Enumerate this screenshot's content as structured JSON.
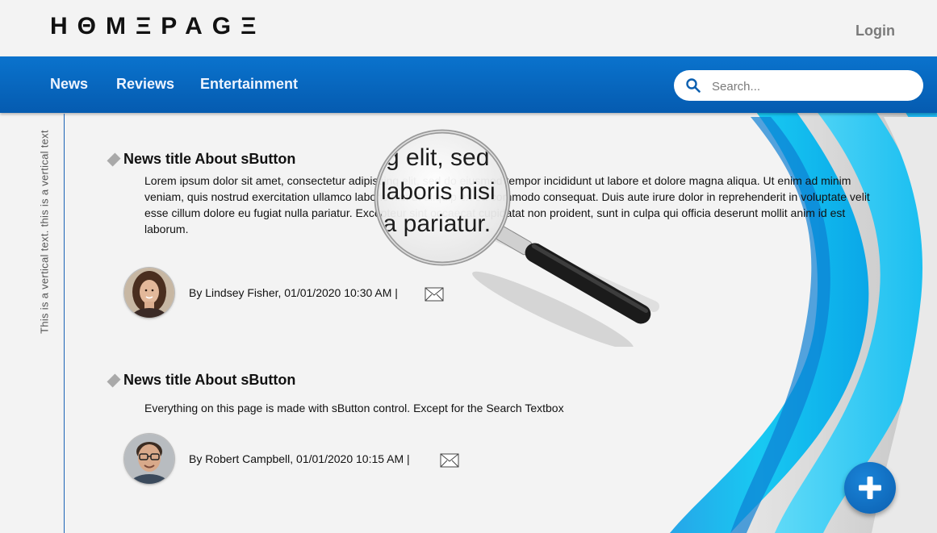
{
  "header": {
    "logo_text": "HΘMΞPAGΞ",
    "login_label": "Login"
  },
  "nav": {
    "items": [
      {
        "label": "News"
      },
      {
        "label": "Reviews"
      },
      {
        "label": "Entertainment"
      }
    ]
  },
  "search": {
    "placeholder": "Search...",
    "value": ""
  },
  "sidebar": {
    "vertical_text": "This is a vertical text. this is a vertical text"
  },
  "articles": [
    {
      "title": "News title About sButton",
      "body": "Lorem ipsum dolor sit amet, consectetur adipiscing elit, sed do eiusmod tempor incididunt ut labore et dolore magna aliqua. Ut enim ad minim veniam, quis nostrud exercitation ullamco laboris nisi ut aliquip ex ea commodo consequat. Duis aute irure dolor in reprehenderit in voluptate velit esse cillum dolore eu fugiat nulla pariatur. Excepteur sint occaecat cupidatat non proident, sunt in culpa qui officia deserunt mollit anim id est laborum.",
      "byline": "By Lindsey Fisher, 01/01/2020 10:30 AM  |"
    },
    {
      "title": "News title About sButton",
      "body": "Everything on this page is made with sButton control. Except for the Search Textbox",
      "byline": "By Robert Campbell, 01/01/2020 10:15 AM  |"
    }
  ],
  "magnifier": {
    "lines": [
      "g elit, sed",
      "laboris nisi",
      "la pariatur."
    ]
  },
  "colors": {
    "nav_blue": "#0a6cc7",
    "accent_cyan": "#19c7f0",
    "fab_blue": "#0b64b8",
    "page_bg": "#f3f3f3"
  },
  "icons": {
    "search": "search-icon",
    "mail": "mail-icon",
    "add": "plus-icon",
    "magnifier": "magnifying-glass-icon",
    "bullet": "diamond-bullet-icon"
  }
}
